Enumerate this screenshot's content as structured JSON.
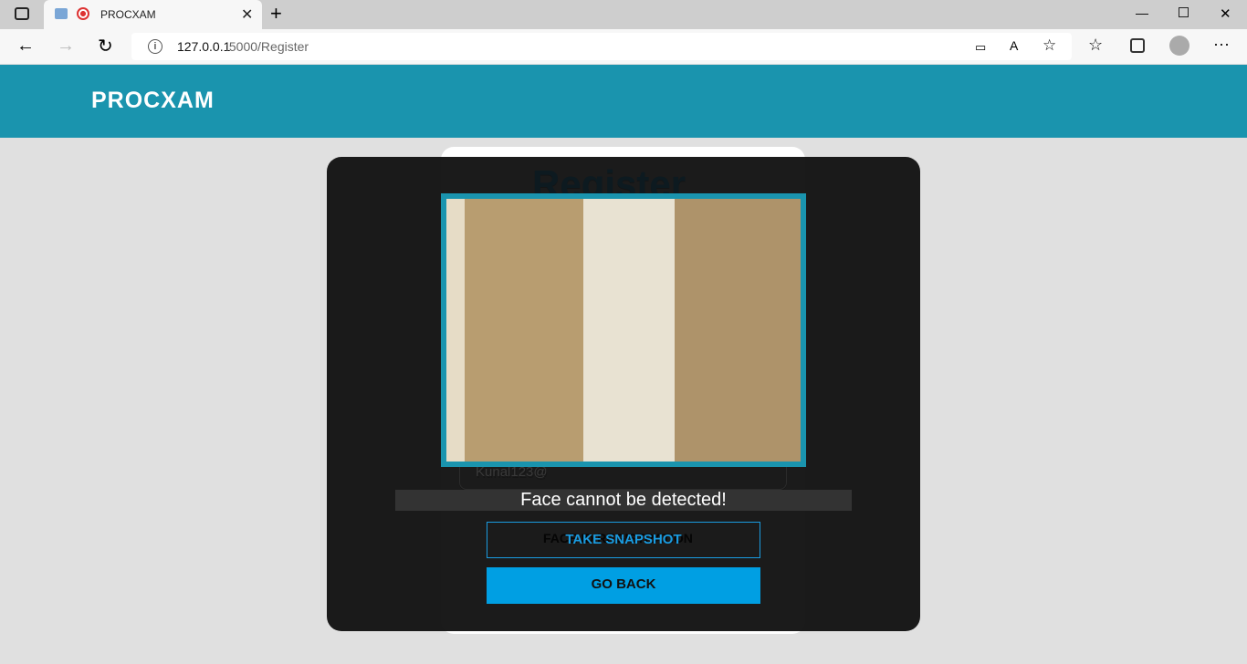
{
  "browser": {
    "tab_title": "PROCXAM",
    "url_host": "127.0.0.1",
    "url_rest": ":5000/Register"
  },
  "header": {
    "brand": "PROCXAM"
  },
  "form": {
    "title": "Register",
    "password_value": "Kunal123@",
    "face_id_button": "FACE ID REGISTRATION"
  },
  "modal": {
    "message": "Face cannot be detected!",
    "snapshot_button": "TAKE SNAPSHOT",
    "back_button": "GO BACK"
  },
  "colors": {
    "brand": "#1a94ae",
    "accent": "#009fe3"
  }
}
